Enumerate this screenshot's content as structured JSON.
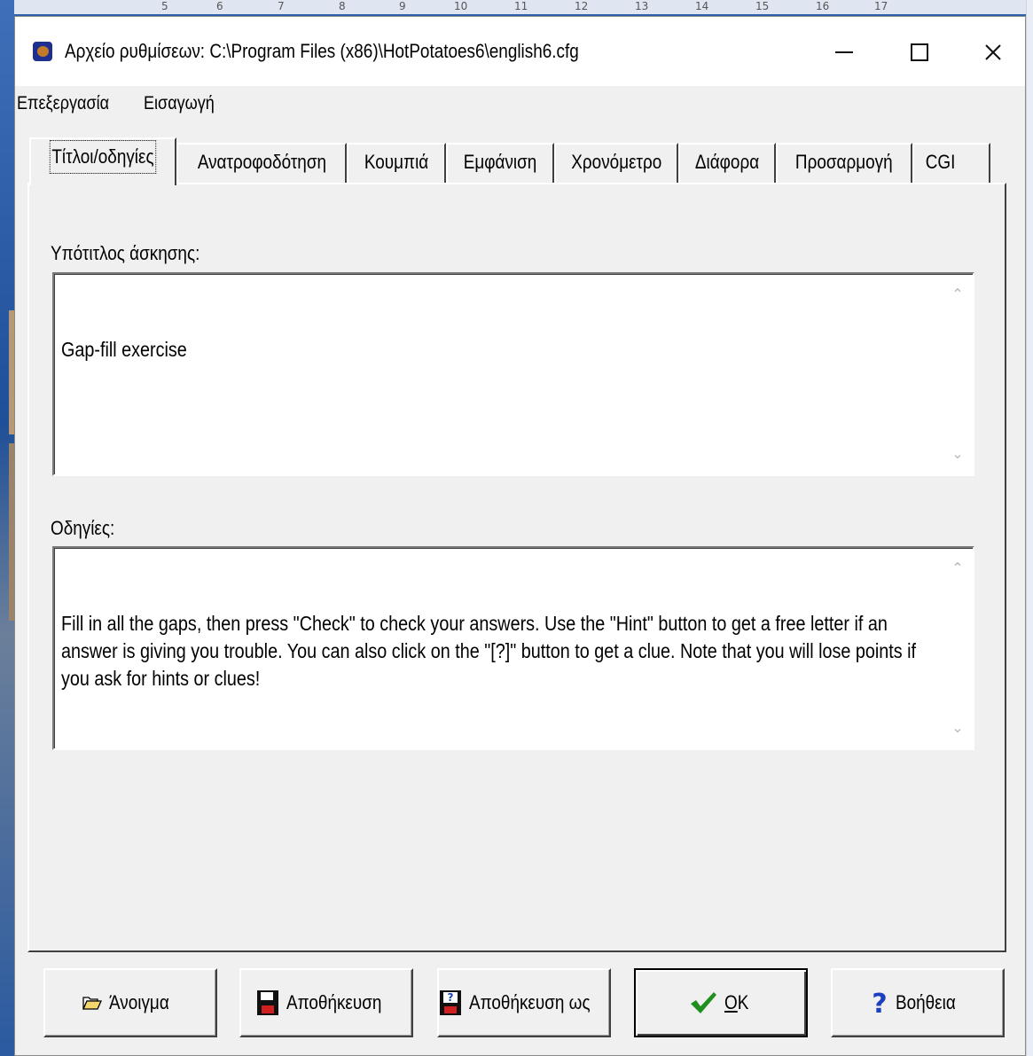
{
  "ruler": {
    "labels": [
      "5",
      "6",
      "7",
      "8",
      "9",
      "10",
      "11",
      "12",
      "13",
      "14",
      "15",
      "16",
      "17"
    ]
  },
  "window": {
    "title": "Αρχείο ρυθμίσεων:  C:\\Program Files (x86)\\HotPotatoes6\\english6.cfg",
    "controls": {
      "minimize": "minimize",
      "maximize": "maximize",
      "close": "close"
    }
  },
  "menu": {
    "items": [
      {
        "label": "Επεξεργασία"
      },
      {
        "label": "Εισαγωγή"
      }
    ]
  },
  "tabs": [
    {
      "label": "Τίτλοι/οδηγίες",
      "active": true
    },
    {
      "label": "Ανατροφοδότηση",
      "active": false
    },
    {
      "label": "Κουμπιά",
      "active": false
    },
    {
      "label": "Εμφάνιση",
      "active": false
    },
    {
      "label": "Χρονόμετρο",
      "active": false
    },
    {
      "label": "Διάφορα",
      "active": false
    },
    {
      "label": "Προσαρμογή",
      "active": false
    },
    {
      "label": "CGI",
      "active": false
    }
  ],
  "form": {
    "subtitle_label": "Υπότιτλος άσκησης:",
    "subtitle_value": "Gap-fill exercise",
    "instructions_label": "Οδηγίες:",
    "instructions_value": "Fill in all the gaps, then press \"Check\" to check your answers. Use the \"Hint\" button to get a free letter if an answer is giving you trouble. You can also click on the \"[?]\" button to get a clue. Note that you will lose points if you ask for hints or clues!"
  },
  "buttons": {
    "open": {
      "label": "Άνοιγμα",
      "icon": "folder-open-icon"
    },
    "save": {
      "label": "Αποθήκευση",
      "icon": "floppy-disk-icon"
    },
    "save_as": {
      "label": "Αποθήκευση ως",
      "icon": "floppy-disk-question-icon"
    },
    "ok": {
      "label_underlined": "O",
      "label_rest": "K",
      "icon": "checkmark-icon"
    },
    "help": {
      "label": "Βοήθεια",
      "icon": "question-mark-icon"
    }
  },
  "colors": {
    "desktop": "#2f5fa8",
    "dialog": "#f0f0f0",
    "checkmark": "#1f8f1f",
    "help_icon": "#1c3fbf"
  }
}
